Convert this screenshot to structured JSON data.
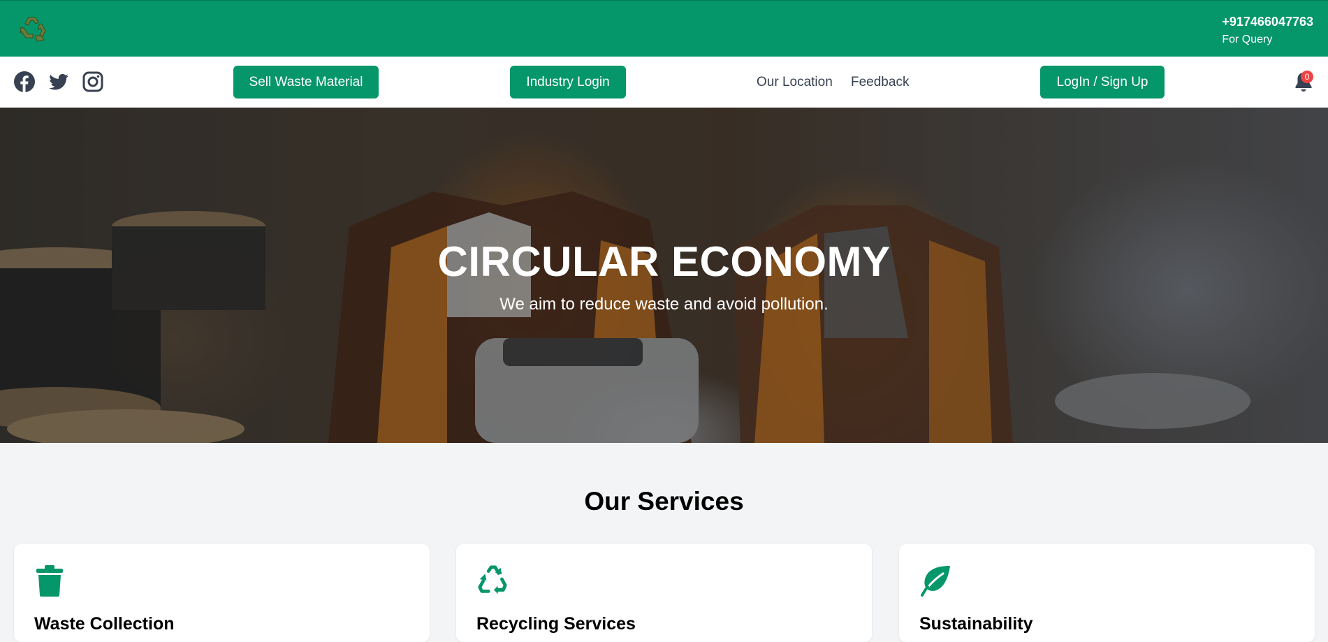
{
  "header": {
    "logo_icon": "recycle-logo-icon",
    "phone": "+917466047763",
    "phone_caption": "For Query",
    "brand_color": "#059669"
  },
  "nav": {
    "social": [
      "facebook-icon",
      "twitter-icon",
      "instagram-icon"
    ],
    "sell_button": "Sell Waste Material",
    "industry_button": "Industry Login",
    "location_link": "Our Location",
    "feedback_link": "Feedback",
    "login_button": "LogIn / Sign Up",
    "notification_count": "0"
  },
  "hero": {
    "title": "CIRCULAR ECONOMY",
    "subtitle": "We aim to reduce waste and avoid pollution."
  },
  "services": {
    "title": "Our Services",
    "cards": [
      {
        "icon": "trash-icon",
        "title": "Waste Collection"
      },
      {
        "icon": "recycle-icon",
        "title": "Recycling Services"
      },
      {
        "icon": "leaf-icon",
        "title": "Sustainability"
      }
    ]
  }
}
